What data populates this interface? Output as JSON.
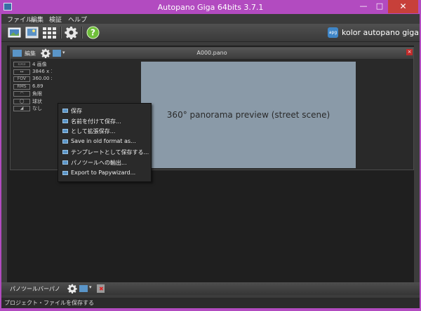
{
  "window": {
    "title": "Autopano Giga 64bits 3.7.1",
    "min": "—",
    "max": "□",
    "close": "✕"
  },
  "menu": [
    "ファイル",
    "編集",
    "検証",
    "ヘルプ"
  ],
  "brand": {
    "logo": "apg",
    "text": "kolor autopano giga"
  },
  "project": {
    "edit_label": "編集",
    "title": "A000.pano",
    "close": "×",
    "dropdown_arrow": "▾",
    "info": [
      {
        "key": "▭▭",
        "value": "4 画像"
      },
      {
        "key": "↔",
        "value": "3846 x 1"
      },
      {
        "key": "FOV",
        "value": "360.00 x"
      },
      {
        "key": "RMS",
        "value": "6.89"
      },
      {
        "key": "◠",
        "value": "魚眼"
      },
      {
        "key": "◯",
        "value": "球状"
      },
      {
        "key": "◢",
        "value": "なし"
      }
    ],
    "preview_placeholder": "360° panorama preview (street scene)"
  },
  "save_menu": [
    "保存",
    "名前を付けて保存...",
    "として拡張保存...",
    "Save in old format as...",
    "テンプレートとして保存する...",
    "パノツールへの輸出...",
    "Export to Papywizard..."
  ],
  "bottom_panel": {
    "label": "パノツールバーパノ",
    "arrow": "▾"
  },
  "status": "プロジェクト・ファイルを保存する"
}
